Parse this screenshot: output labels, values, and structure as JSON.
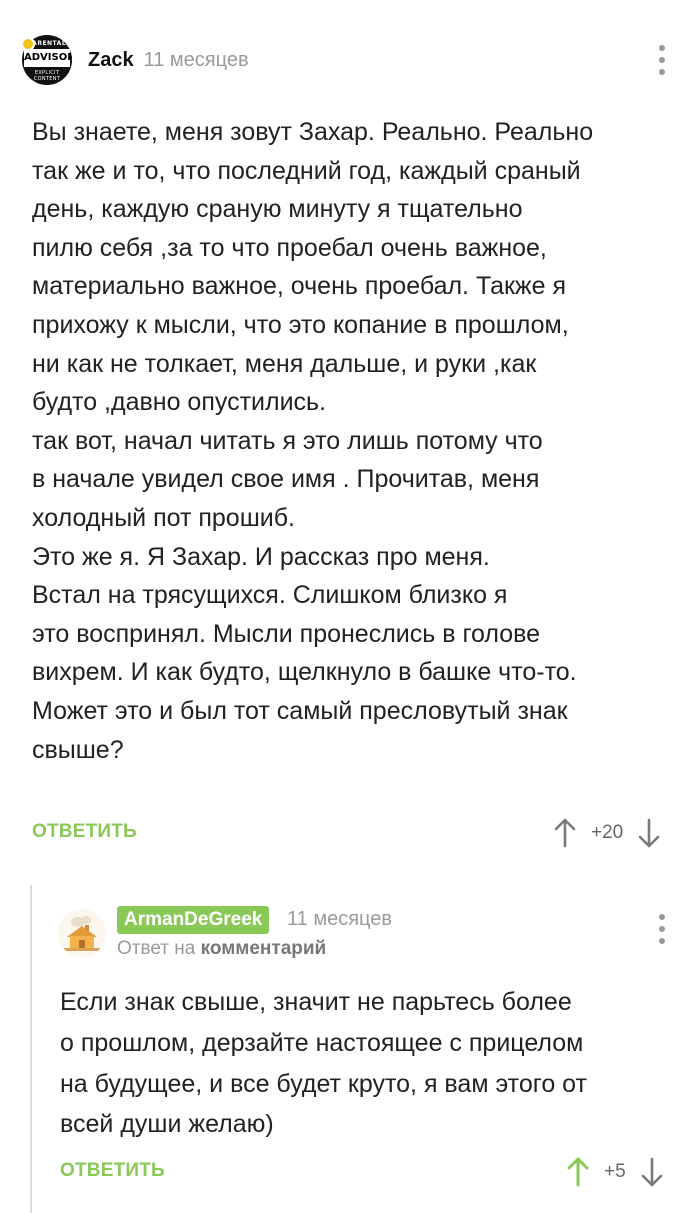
{
  "comment": {
    "author": "Zack",
    "time": "11 месяцев",
    "avatar_text": {
      "top": "PARENTAL",
      "middle": "ADVISORY",
      "bottom": "EXPLICIT CONTENT"
    },
    "lines": [
      "Вы знаете, меня зовут Захар. Реально. Реально",
      "так же и то, что последний год, каждый сраный",
      "день, каждую сраную минуту я тщательно",
      "пилю себя ,за то что проебал очень важное,",
      "материально важное, очень проебал. Также я",
      "прихожу к мысли, что это копание в прошлом,",
      "ни как не толкает, меня дальше, и руки ,как",
      "будто ,давно опустились.",
      "так вот, начал читать я это лишь потому что",
      "в начале увидел свое имя . Прочитав, меня",
      "холодный пот прошиб.",
      "Это же я. Я Захар. И рассказ про меня.",
      "Встал на трясущихся. Слишком близко я",
      "это воспринял. Мысли пронеслись в голове",
      "вихрем. И как будто, щелкнуло в башке что-то.",
      "Может это и был тот самый пресловутый знак",
      "свыше?"
    ],
    "reply_label": "ОТВЕТИТЬ",
    "rating": "+20"
  },
  "reply": {
    "author": "ArmanDeGreek",
    "time": "11 месяцев",
    "reply_to_prefix": "Ответ на",
    "reply_to_target": "комментарий",
    "lines": [
      "Если знак свыше, значит не парьтесь более",
      "о прошлом, дерзайте настоящее с прицелом",
      "на будущее, и все будет круто, я вам этого от",
      "всей души желаю)"
    ],
    "reply_label": "ОТВЕТИТЬ",
    "rating": "+5"
  },
  "colors": {
    "accent": "#8ac858",
    "muted": "#9a9a9a",
    "text": "#222222"
  }
}
